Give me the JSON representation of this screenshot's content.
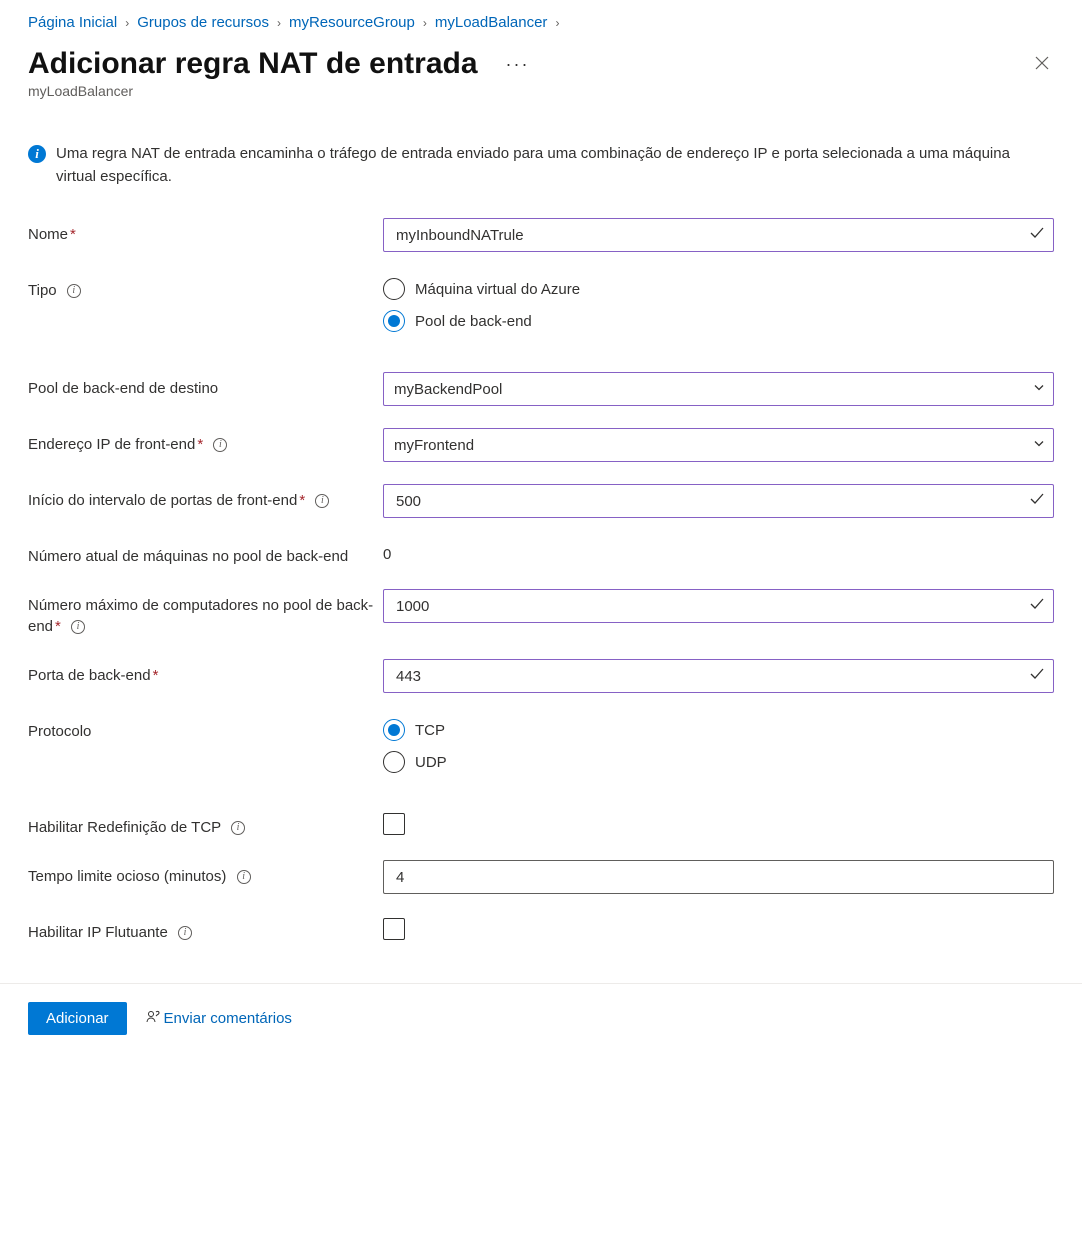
{
  "breadcrumb": {
    "items": [
      {
        "label": "Página Inicial"
      },
      {
        "label": "Grupos de recursos"
      },
      {
        "label": "myResourceGroup"
      },
      {
        "label": "myLoadBalancer"
      }
    ]
  },
  "header": {
    "title": "Adicionar regra NAT de entrada",
    "subtitle": "myLoadBalancer"
  },
  "infobox": {
    "text": "Uma regra NAT de entrada encaminha o tráfego de entrada enviado para uma combinação de endereço IP e porta selecionada a uma máquina virtual específica."
  },
  "form": {
    "name": {
      "label": "Nome",
      "value": "myInboundNATrule"
    },
    "type": {
      "label": "Tipo",
      "options": [
        {
          "label": "Máquina virtual do Azure",
          "selected": false
        },
        {
          "label": "Pool de back-end",
          "selected": true
        }
      ]
    },
    "backend_pool": {
      "label": "Pool de back-end de destino",
      "value": "myBackendPool"
    },
    "frontend_ip": {
      "label": "Endereço IP de front-end",
      "value": "myFrontend"
    },
    "port_range_start": {
      "label": "Início do intervalo de portas de front-end",
      "value": "500"
    },
    "current_machines": {
      "label": "Número atual de máquinas no pool de back-end",
      "value": "0"
    },
    "max_machines": {
      "label": "Número máximo de computadores no pool de back-end",
      "value": "1000"
    },
    "backend_port": {
      "label": "Porta de back-end",
      "value": "443"
    },
    "protocol": {
      "label": "Protocolo",
      "options": [
        {
          "label": "TCP",
          "selected": true
        },
        {
          "label": "UDP",
          "selected": false
        }
      ]
    },
    "tcp_reset": {
      "label": "Habilitar Redefinição de TCP"
    },
    "idle_timeout": {
      "label": "Tempo limite ocioso (minutos)",
      "value": "4"
    },
    "floating_ip": {
      "label": "Habilitar IP Flutuante"
    }
  },
  "footer": {
    "add_button": "Adicionar",
    "feedback": "Enviar comentários"
  }
}
